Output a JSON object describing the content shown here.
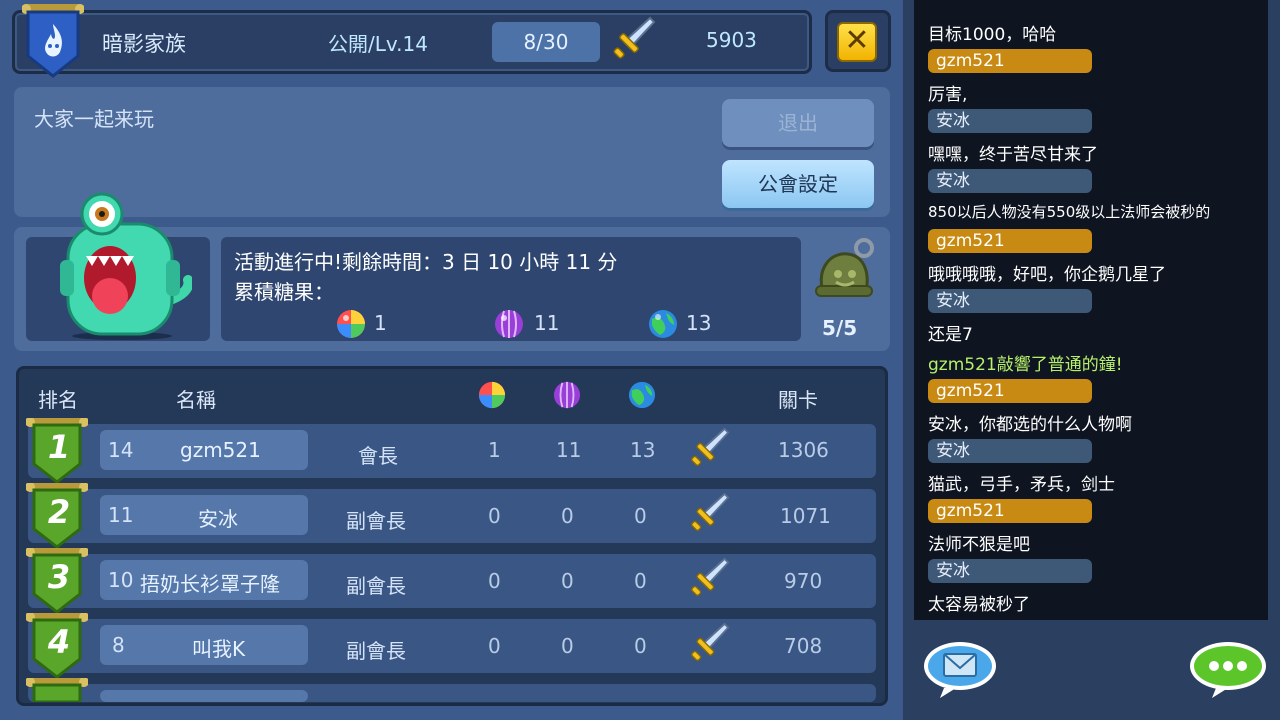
{
  "guild": {
    "name": "暗影家族",
    "status": "公開/Lv.14",
    "members": "8/30",
    "power": "5903",
    "announcement": "大家一起来玩"
  },
  "buttons": {
    "close": "✕",
    "leave": "退出",
    "settings": "公會設定"
  },
  "event": {
    "time_text": "活動進行中!剩餘時間：3 日 10 小時 11 分",
    "candy_label": "累積糖果：",
    "candies": [
      {
        "icon": "rainbow-candy-icon",
        "count": "1"
      },
      {
        "icon": "purple-candy-icon",
        "count": "11"
      },
      {
        "icon": "globe-candy-icon",
        "count": "13"
      }
    ],
    "bell_count": "5/5"
  },
  "table": {
    "headers": {
      "rank": "排名",
      "name": "名稱",
      "stage": "關卡"
    },
    "rows": [
      {
        "rank": "1",
        "level": "14",
        "name": "gzm521",
        "role": "會長",
        "c1": "1",
        "c2": "11",
        "c3": "13",
        "stage": "1306"
      },
      {
        "rank": "2",
        "level": "11",
        "name": "安冰",
        "role": "副會長",
        "c1": "0",
        "c2": "0",
        "c3": "0",
        "stage": "1071"
      },
      {
        "rank": "3",
        "level": "10",
        "name": "捂奶长衫罩子隆",
        "role": "副會長",
        "c1": "0",
        "c2": "0",
        "c3": "0",
        "stage": "970"
      },
      {
        "rank": "4",
        "level": "8",
        "name": "叫我K",
        "role": "副會長",
        "c1": "0",
        "c2": "0",
        "c3": "0",
        "stage": "708"
      }
    ]
  },
  "chat": [
    {
      "type": "msg",
      "text": "目标1000，哈哈"
    },
    {
      "type": "name",
      "color": "gold",
      "text": "gzm521"
    },
    {
      "type": "msg",
      "text": "厉害,"
    },
    {
      "type": "name",
      "color": "blue",
      "text": "安冰"
    },
    {
      "type": "msg",
      "text": "嘿嘿，终于苦尽甘来了"
    },
    {
      "type": "name",
      "color": "blue",
      "text": "安冰"
    },
    {
      "type": "msg",
      "text": "850以后人物没有550级以上法师会被秒的"
    },
    {
      "type": "name",
      "color": "gold",
      "text": "gzm521"
    },
    {
      "type": "msg",
      "text": "哦哦哦哦，好吧，你企鹅几星了"
    },
    {
      "type": "name",
      "color": "blue",
      "text": "安冰"
    },
    {
      "type": "msg",
      "text": "还是7"
    },
    {
      "type": "sys",
      "text": "gzm521敲響了普通的鐘!"
    },
    {
      "type": "name",
      "color": "gold",
      "text": "gzm521"
    },
    {
      "type": "msg",
      "text": "安冰，你都选的什么人物啊"
    },
    {
      "type": "name",
      "color": "blue",
      "text": "安冰"
    },
    {
      "type": "msg",
      "text": "猫武，弓手，矛兵，剑士"
    },
    {
      "type": "name",
      "color": "gold",
      "text": "gzm521"
    },
    {
      "type": "msg",
      "text": "法师不狠是吧"
    },
    {
      "type": "name",
      "color": "blue",
      "text": "安冰"
    },
    {
      "type": "msg",
      "text": "太容易被秒了"
    }
  ],
  "colors": {
    "panel": "#4e6d9c",
    "dark_panel": "#2e4670",
    "gold_name": "#c88a12",
    "blue_name": "#3e5878",
    "system_msg": "#b6f06a"
  }
}
